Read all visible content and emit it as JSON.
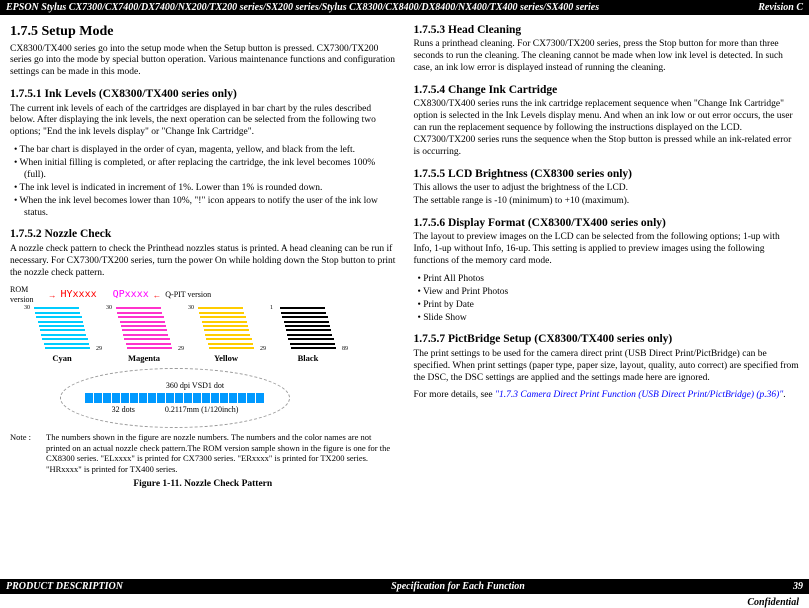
{
  "header": {
    "left": "EPSON Stylus CX7300/CX7400/DX7400/NX200/TX200 series/SX200 series/Stylus CX8300/CX8400/DX8400/NX400/TX400 series/SX400 series",
    "right": "Revision C"
  },
  "footer": {
    "left": "PRODUCT DESCRIPTION",
    "center": "Specification for Each Function",
    "right": "39",
    "confidential": "Confidential"
  },
  "left": {
    "h_setup": "1.7.5  Setup Mode",
    "p_setup": "CX8300/TX400 series go into the setup mode when the Setup button is pressed. CX7300/TX200 series go into the mode by special button operation. Various maintenance functions and configuration settings can be made in this mode.",
    "h_ink": "1.7.5.1  Ink Levels (CX8300/TX400 series only)",
    "p_ink": "The current ink levels of each of the cartridges are displayed in bar chart by the rules described below. After displaying the ink levels, the next operation can be selected from the following two options; \"End the ink levels display\" or \"Change Ink Cartridge\".",
    "ink_items": [
      "The bar chart is displayed in the order of cyan, magenta, yellow, and black from the left.",
      "When initial filling is completed, or after replacing the cartridge, the ink level becomes 100% (full).",
      "The ink level is indicated in increment of 1%. Lower than 1% is rounded down.",
      "When the ink level becomes lower than 10%, \"!\" icon appears to notify the user of the ink low status."
    ],
    "h_nozzle": "1.7.5.2  Nozzle Check",
    "p_nozzle": "A nozzle check pattern to check the Printhead nozzles status is printed. A head cleaning can be run if necessary. For CX7300/TX200 series, turn the power On while holding down the Stop button to print the nozzle check pattern.",
    "fig": {
      "rom_label": "ROM version",
      "hy": "HYxxxx",
      "qp": "QPxxxx",
      "qpit": "Q-PIT version",
      "colors": [
        "Cyan",
        "Magenta",
        "Yellow",
        "Black"
      ],
      "dpi": "360 dpi VSD1 dot",
      "dots": "32 dots",
      "mm": "0.2117mm (1/120inch)",
      "note_label": "Note  :",
      "note": "The numbers shown in the figure are nozzle numbers. The numbers and the color names are not printed on an actual nozzle check pattern.The ROM version sample shown in the figure is one for the CX8300 series. \"ELxxxx\" is printed for CX7300 series. \"ERxxxx\" is printed for TX200 series. \"HRxxxx\" is printed for TX400 series.",
      "caption": "Figure 1-11.  Nozzle Check Pattern"
    }
  },
  "right": {
    "h_head": "1.7.5.3  Head Cleaning",
    "p_head": "Runs a printhead cleaning. For CX7300/TX200 series, press the Stop button for more than three seconds to run the cleaning. The cleaning cannot be made when low ink level is detected. In such case, an ink low error is displayed instead of running the cleaning.",
    "h_change": "1.7.5.4  Change Ink Cartridge",
    "p_change": "CX8300/TX400 series runs the ink cartridge replacement sequence when \"Change Ink Cartridge\" option is selected in the Ink Levels display menu. And when an ink low or out error occurs, the user can run the replacement sequence by following the instructions displayed on the LCD. CX7300/TX200 series runs the sequence when the Stop button is pressed while an ink-related error is occurring.",
    "h_lcd": "1.7.5.5  LCD Brightness (CX8300 series only)",
    "p_lcd1": "This allows the user to adjust the brightness of the LCD.",
    "p_lcd2": "The settable range is -10 (minimum) to +10 (maximum).",
    "h_disp": "1.7.5.6  Display Format (CX8300/TX400 series only)",
    "p_disp": "The layout to preview images on the LCD can be selected from the following options; 1-up with Info, 1-up without Info, 16-up. This setting is applied to preview images using the following functions of the memory card mode.",
    "disp_items": [
      "Print All Photos",
      "View and Print Photos",
      "Print by Date",
      "Slide Show"
    ],
    "h_pict": "1.7.5.7  PictBridge Setup (CX8300/TX400 series only)",
    "p_pict1": "The print settings to be used for the camera direct print (USB Direct Print/PictBridge) can be specified. When print settings (paper type, paper size, layout, quality, auto correct) are specified from the DSC, the DSC settings are applied and the settings made here are ignored.",
    "p_pict2a": "For more details, see ",
    "p_pict2b": "\"1.7.3 Camera Direct Print Function (USB Direct Print/PictBridge) (p.36)\"",
    "p_pict2c": "."
  }
}
